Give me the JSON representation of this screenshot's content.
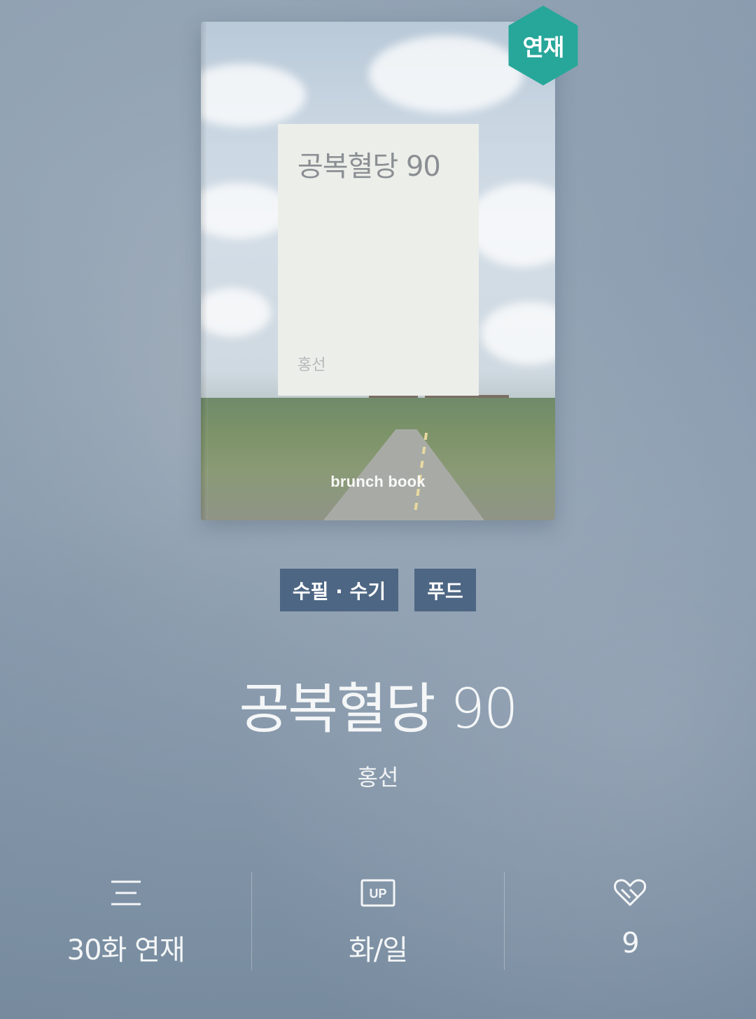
{
  "badge": {
    "label": "연재"
  },
  "cover": {
    "label_title": "공복혈당 90",
    "label_author": "홍선",
    "brand": "brunch book"
  },
  "tags": [
    "수필 · 수기",
    "푸드"
  ],
  "book": {
    "title": "공복혈당 90",
    "author": "홍선"
  },
  "stats": {
    "episodes": {
      "icon": "list-icon",
      "value": "30화 연재"
    },
    "schedule": {
      "icon": "up-icon",
      "value": "화/일"
    },
    "likes": {
      "icon": "heart-icon",
      "value": "9"
    }
  },
  "colors": {
    "badge": "#27a79a",
    "tag_bg": "#4d6683"
  }
}
